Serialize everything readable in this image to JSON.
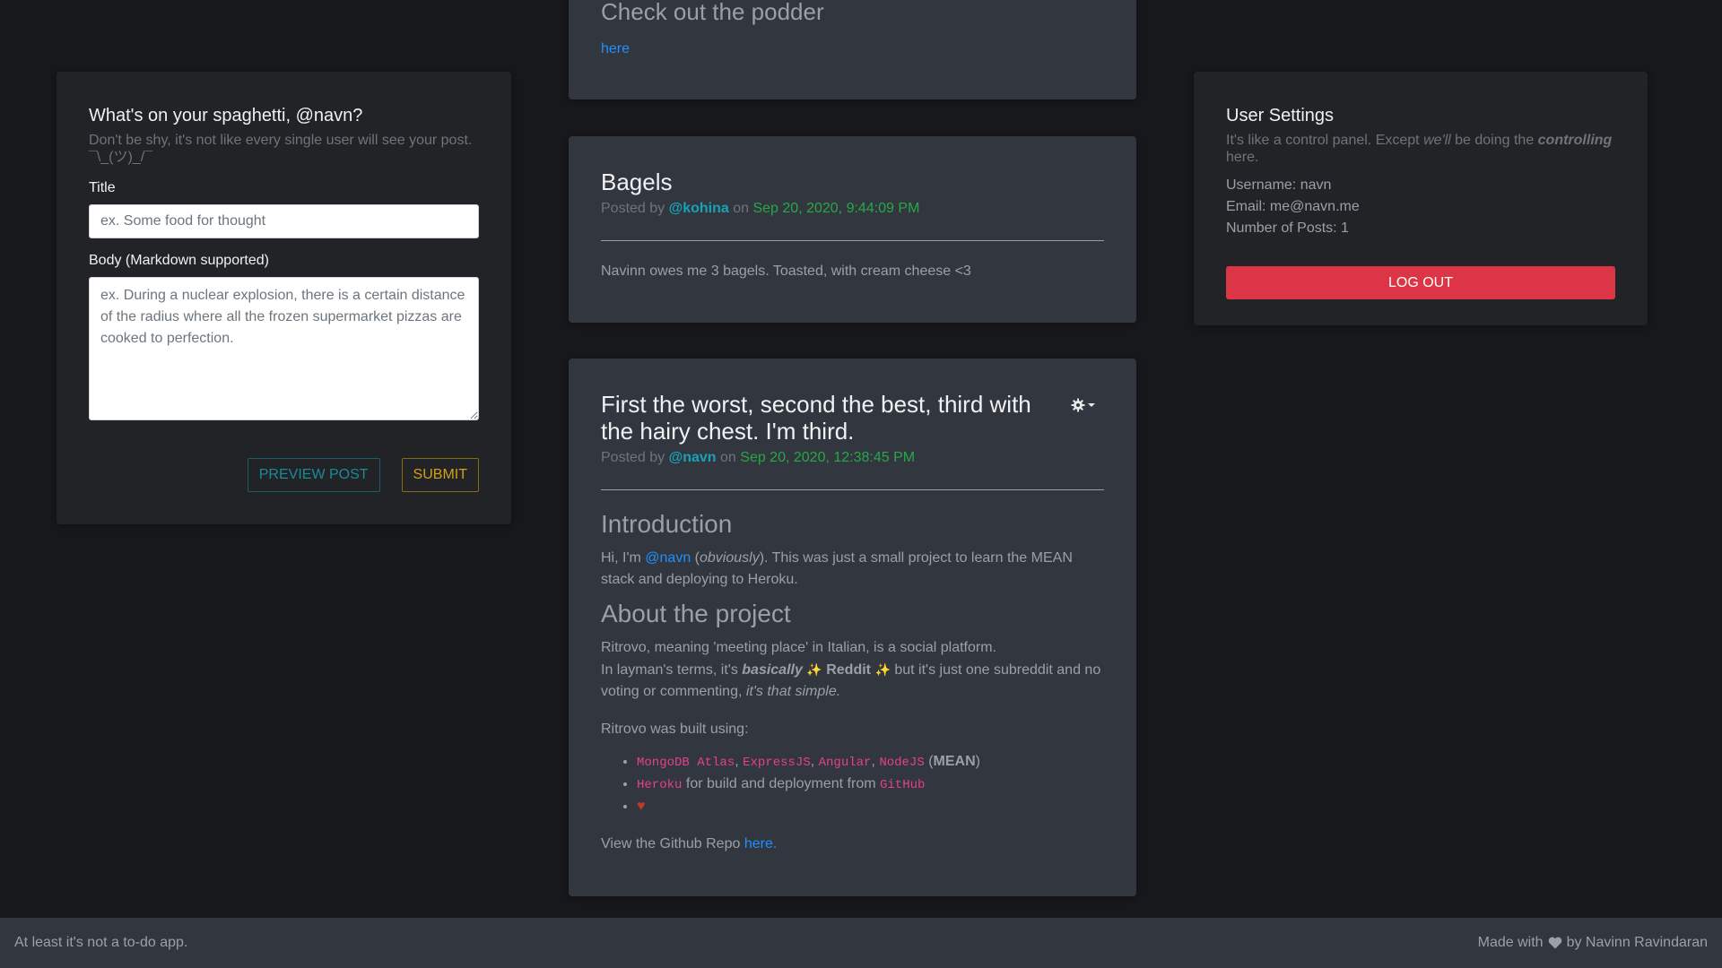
{
  "create_post": {
    "title": "What's on your spaghetti, @navn?",
    "subtitle": "Don't be shy, it's not like every single user will see your post. ¯\\_(ツ)_/¯",
    "title_label": "Title",
    "title_placeholder": "ex. Some food for thought",
    "body_label": "Body (Markdown supported)",
    "body_placeholder": "ex. During a nuclear explosion, there is a certain distance of the radius where all the frozen supermarket pizzas are cooked to perfection.",
    "preview_label": "PREVIEW POST",
    "submit_label": "SUBMIT"
  },
  "podder_post": {
    "title": "Check out the podder",
    "link": "here"
  },
  "bagels_post": {
    "title": "Bagels",
    "posted_by": "Posted by",
    "author": "@kohina",
    "on": "on",
    "date": "Sep 20, 2020, 9:44:09 PM",
    "body": "Navinn owes me 3 bagels. Toasted, with cream cheese <3"
  },
  "readme_post": {
    "title": "First the worst, second the best, third with the hairy chest. I'm third.",
    "posted_by": "Posted by",
    "author": "@navn",
    "on": "on",
    "date": "Sep 20, 2020, 12:38:45 PM",
    "intro_heading": "Introduction",
    "intro_text_1": "Hi, I'm ",
    "intro_link": "@navn",
    "intro_text_2": " (",
    "intro_em": "obviously",
    "intro_text_3": "). This was just a small project to learn the MEAN stack and deploying to Heroku.",
    "about_heading": "About the project",
    "about_line_1": "Ritrovo, meaning 'meeting place' in Italian, is a social platform.",
    "about_line_2a": "In layman's terms, it's ",
    "about_line_2b": "basically",
    "about_line_2c": "Reddit",
    "about_line_2d": " but it's just one subreddit and no voting or commenting, ",
    "about_line_2e": "it's that simple.",
    "built_using": "Ritrovo was built using:",
    "list": {
      "mongo": "MongoDB Atlas",
      "express": "ExpressJS",
      "angular": "Angular",
      "node": "NodeJS",
      "mean_open": " (",
      "mean": "MEAN",
      "mean_close": ")",
      "heroku": "Heroku",
      "heroku_text": " for build and deployment from ",
      "github": "GitHub"
    },
    "repo_text": "View the Github Repo ",
    "repo_link": "here."
  },
  "settings": {
    "title": "User Settings",
    "subtitle_1": "It's like a control panel. Except ",
    "subtitle_em": "we'll",
    "subtitle_2": " be doing the ",
    "subtitle_strong": "controlling",
    "subtitle_3": " here.",
    "username": "Username: navn",
    "email": "Email: me@navn.me",
    "posts": "Number of Posts: 1",
    "logout_label": "LOG OUT"
  },
  "footer": {
    "left": "At least it's not a to-do app.",
    "made_with": "Made with",
    "by": "by Navinn Ravindaran"
  },
  "icons": {
    "gear": "gear-icon",
    "heart": "heart-icon",
    "sparkle": "sparkles-icon"
  },
  "colors": {
    "background": "#16181c",
    "card": "#212327",
    "feed_card": "#32373f",
    "author": "#17a2b8",
    "date": "#28a745",
    "link": "#1e90ff",
    "danger": "#dc3545",
    "code": "#e83e8c"
  }
}
